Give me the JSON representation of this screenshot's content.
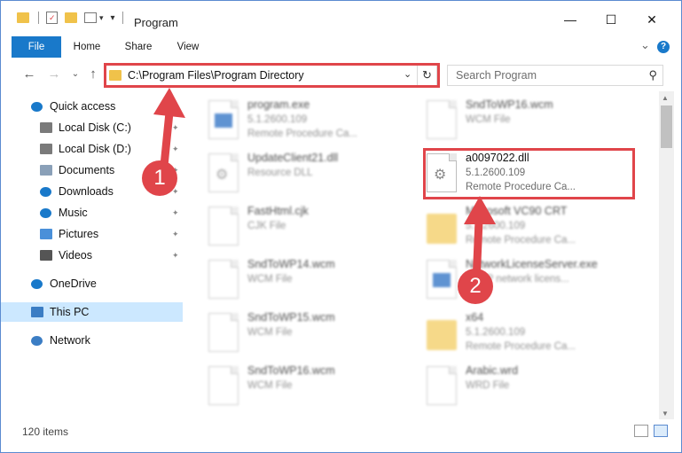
{
  "window": {
    "title": "Program",
    "minimize_glyph": "—",
    "maximize_glyph": "☐",
    "close_glyph": "✕"
  },
  "ribbon": {
    "tabs": [
      {
        "label": "File"
      },
      {
        "label": "Home"
      },
      {
        "label": "Share"
      },
      {
        "label": "View"
      }
    ],
    "expand_glyph": "⌄",
    "help_glyph": "?"
  },
  "nav": {
    "back_glyph": "←",
    "forward_glyph": "→",
    "recent_glyph": "⌄",
    "up_glyph": "↑"
  },
  "address": {
    "path": "C:\\Program Files\\Program Directory",
    "dropdown_glyph": "⌄",
    "refresh_glyph": "↻"
  },
  "search": {
    "placeholder": "Search Program",
    "icon_glyph": "⚲"
  },
  "sidebar": {
    "items": [
      {
        "label": "Quick access",
        "icon": "star-icon",
        "color": "#1979ca"
      },
      {
        "label": "Local Disk (C:)",
        "icon": "drive-icon",
        "color": "#7a7a7a",
        "pinned": true
      },
      {
        "label": "Local Disk (D:)",
        "icon": "drive-icon",
        "color": "#7a7a7a",
        "pinned": true
      },
      {
        "label": "Documents",
        "icon": "documents-icon",
        "color": "#8aa0b8",
        "pinned": true
      },
      {
        "label": "Downloads",
        "icon": "downloads-icon",
        "color": "#1979ca",
        "pinned": true
      },
      {
        "label": "Music",
        "icon": "music-icon",
        "color": "#1979ca",
        "pinned": true
      },
      {
        "label": "Pictures",
        "icon": "pictures-icon",
        "color": "#4a90d9",
        "pinned": true
      },
      {
        "label": "Videos",
        "icon": "videos-icon",
        "color": "#555555",
        "pinned": true
      },
      {
        "label": "OneDrive",
        "icon": "onedrive-icon",
        "color": "#1979ca"
      },
      {
        "label": "This PC",
        "icon": "computer-icon",
        "color": "#3b7dc4",
        "selected": true
      },
      {
        "label": "Network",
        "icon": "network-icon",
        "color": "#3b7dc4"
      }
    ],
    "pin_glyph": "✦"
  },
  "files": [
    {
      "name": "program.exe",
      "line2": "5.1.2600.109",
      "line3": "Remote Procedure Ca...",
      "icon": "exe-icon",
      "blurred": true
    },
    {
      "name": "SndToWP16.wcm",
      "line2": "WCM File",
      "line3": "",
      "icon": "document-icon",
      "blurred": true
    },
    {
      "name": "UpdateClient21.dll",
      "line2": "Resource DLL",
      "line3": "",
      "icon": "dll-icon",
      "blurred": true
    },
    {
      "name": "a0097022.dll",
      "line2": "5.1.2600.109",
      "line3": "Remote Procedure Ca...",
      "icon": "dll-icon",
      "blurred": false
    },
    {
      "name": "FastHtml.cjk",
      "line2": "CJK File",
      "line3": "",
      "icon": "document-icon",
      "blurred": true
    },
    {
      "name": "Microsoft VC90 CRT",
      "line2": "5.1.2600.109",
      "line3": "Remote Procedure Ca...",
      "icon": "folder-icon",
      "blurred": true
    },
    {
      "name": "SndToWP14.wcm",
      "line2": "WCM File",
      "line3": "",
      "icon": "document-icon",
      "blurred": true
    },
    {
      "name": "NetworkLicenseServer.exe",
      "line2": "HASP network licens...",
      "line3": "",
      "icon": "exe-icon",
      "blurred": true
    },
    {
      "name": "SndToWP15.wcm",
      "line2": "WCM File",
      "line3": "",
      "icon": "document-icon",
      "blurred": true
    },
    {
      "name": "x64",
      "line2": "5.1.2600.109",
      "line3": "Remote Procedure Ca...",
      "icon": "folder-icon",
      "blurred": true
    },
    {
      "name": "SndToWP16.wcm",
      "line2": "WCM File",
      "line3": "",
      "icon": "document-icon",
      "blurred": true
    },
    {
      "name": "Arabic.wrd",
      "line2": "WRD File",
      "line3": "",
      "icon": "document-icon",
      "blurred": true
    }
  ],
  "status": {
    "item_count": "120 items"
  },
  "annotations": {
    "badge1": "1",
    "badge2": "2",
    "color": "#e0454a"
  }
}
